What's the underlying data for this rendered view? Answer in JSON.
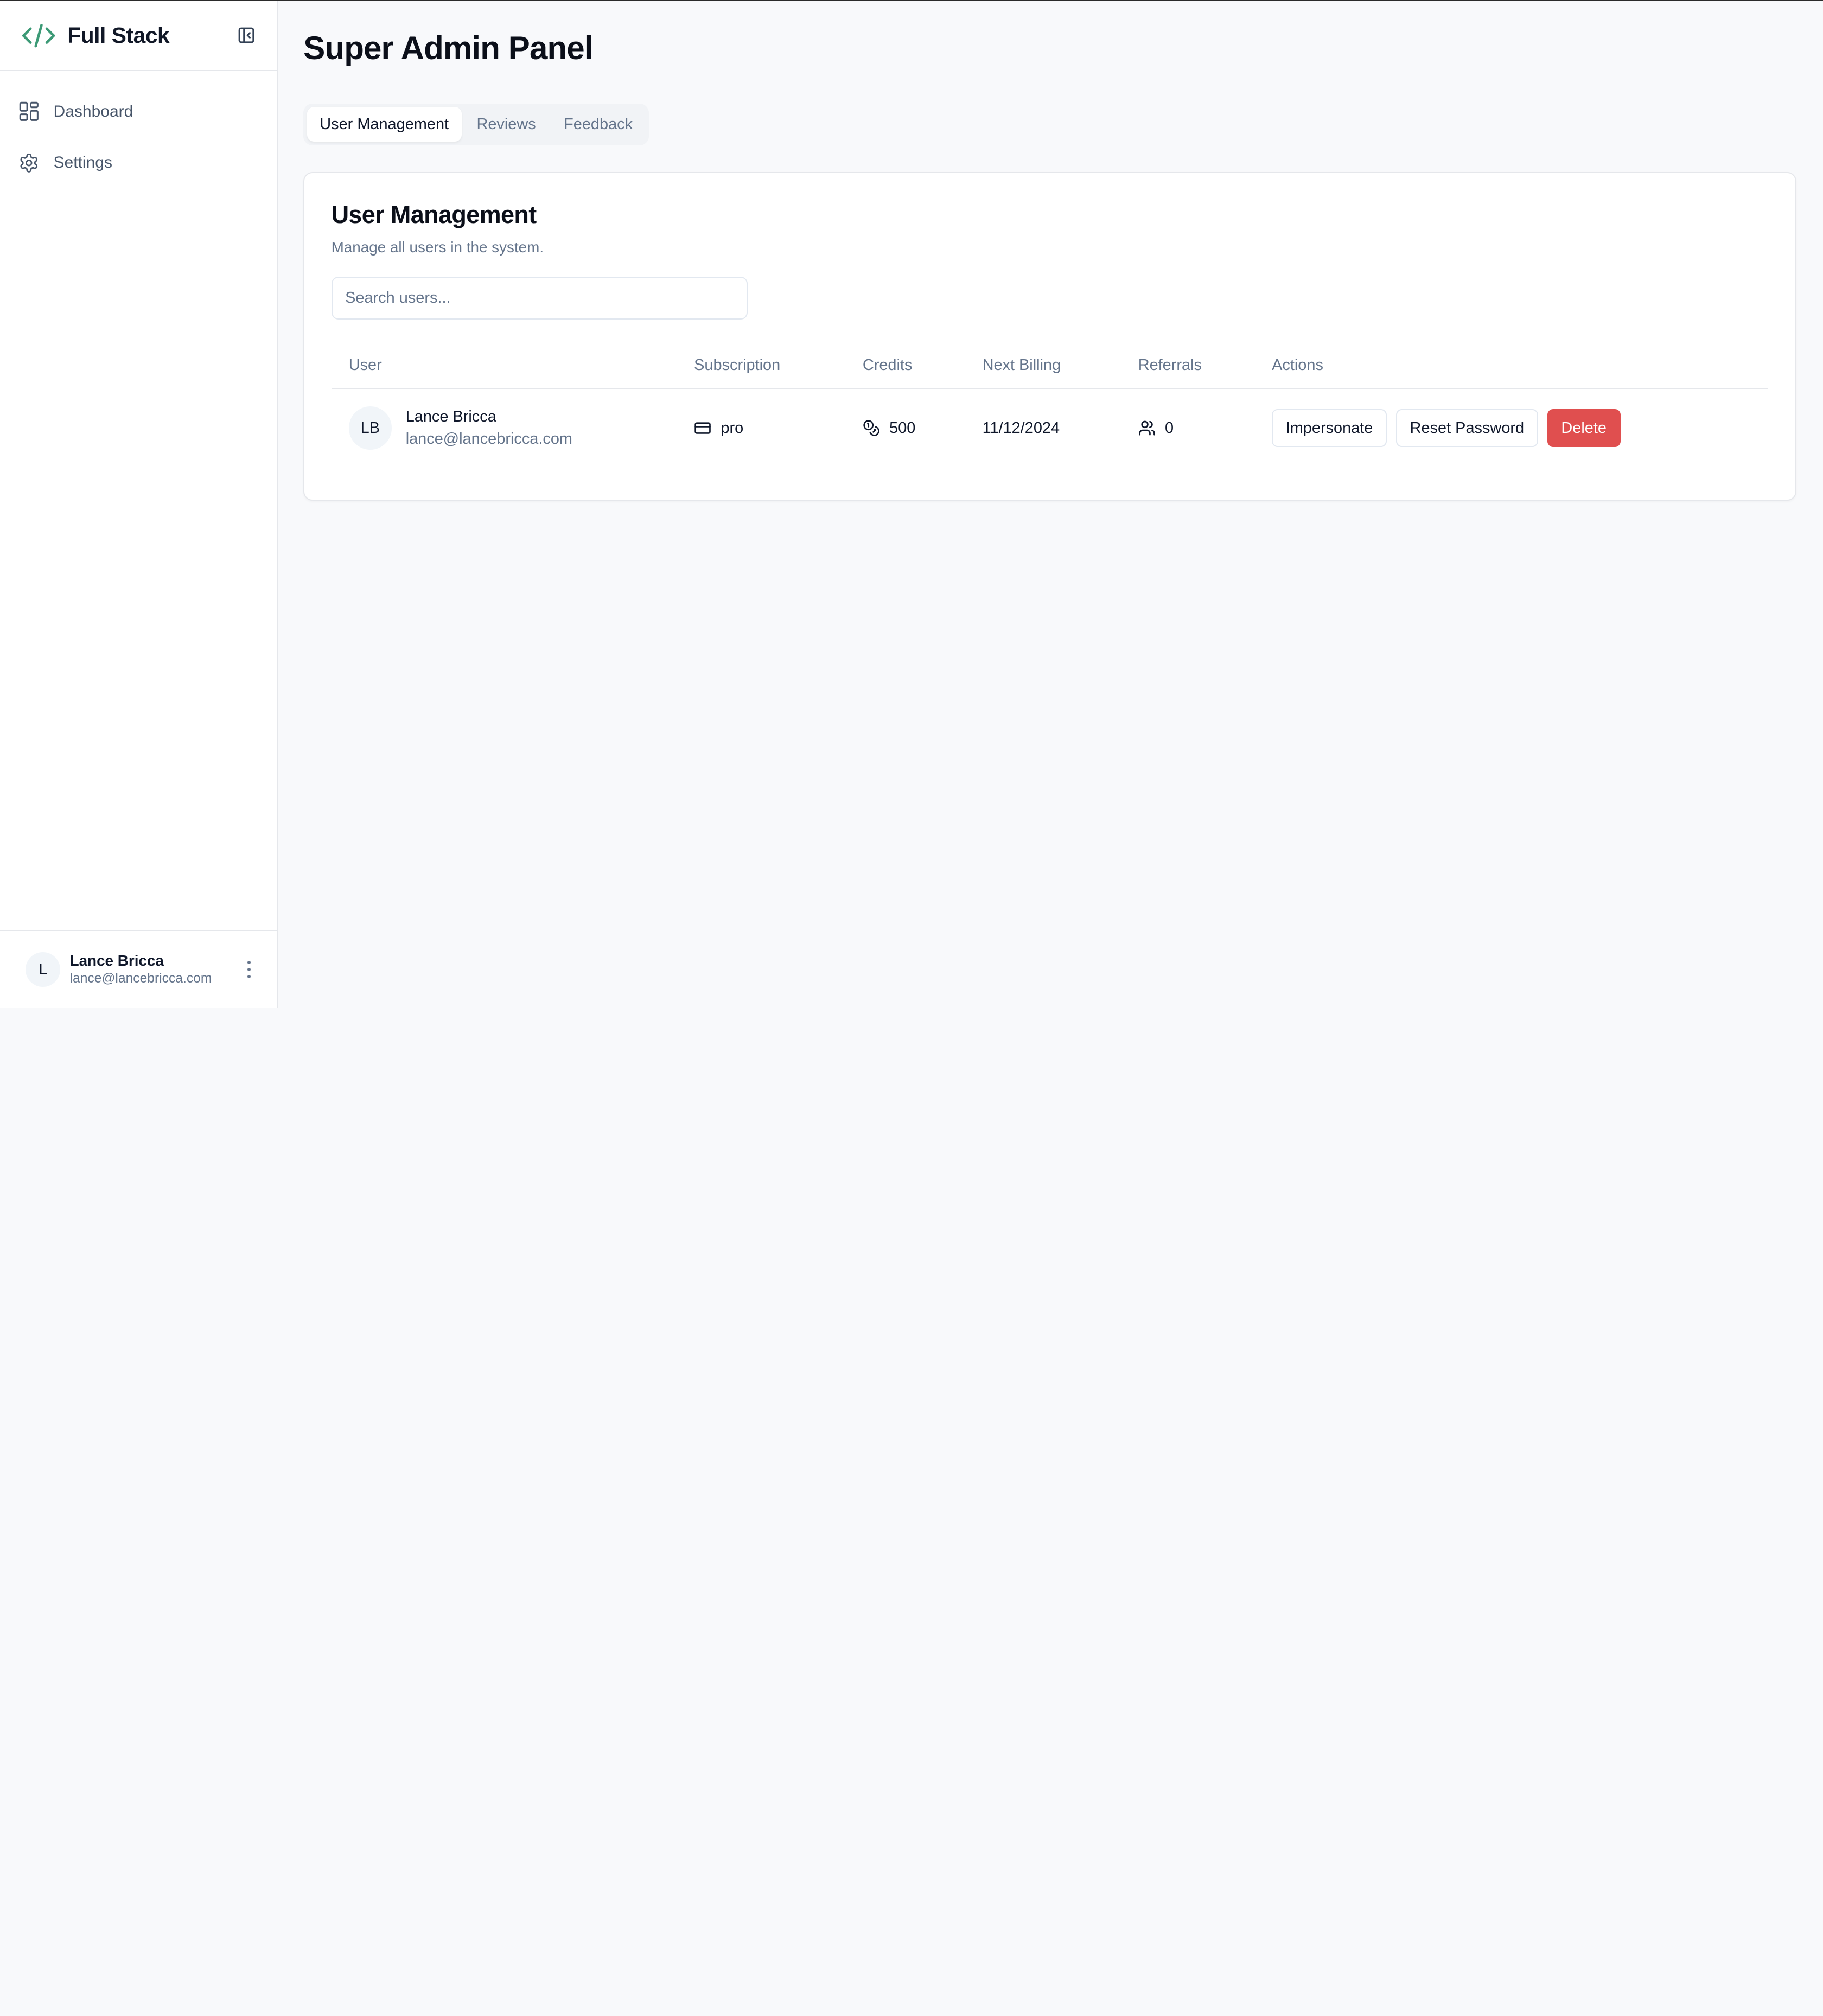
{
  "sidebar": {
    "brand": "Full Stack",
    "items": [
      {
        "label": "Dashboard",
        "icon": "layout-grid-icon"
      },
      {
        "label": "Settings",
        "icon": "gear-icon"
      }
    ],
    "user": {
      "initial": "L",
      "name": "Lance Bricca",
      "email": "lance@lancebricca.com"
    }
  },
  "main": {
    "title": "Super Admin Panel",
    "tabs": [
      {
        "label": "User Management",
        "active": true
      },
      {
        "label": "Reviews",
        "active": false
      },
      {
        "label": "Feedback",
        "active": false
      }
    ],
    "card": {
      "title": "User Management",
      "subtitle": "Manage all users in the system.",
      "search_placeholder": "Search users...",
      "columns": [
        "User",
        "Subscription",
        "Credits",
        "Next Billing",
        "Referrals",
        "Actions"
      ],
      "rows": [
        {
          "initials": "LB",
          "name": "Lance Bricca",
          "email": "lance@lancebricca.com",
          "subscription": "pro",
          "credits": "500",
          "next_billing": "11/12/2024",
          "referrals": "0",
          "actions": {
            "impersonate": "Impersonate",
            "reset": "Reset Password",
            "delete": "Delete"
          }
        }
      ]
    }
  },
  "colors": {
    "brand_accent": "#3c9a76",
    "danger": "#e04f4f",
    "muted_text": "#64748b"
  }
}
